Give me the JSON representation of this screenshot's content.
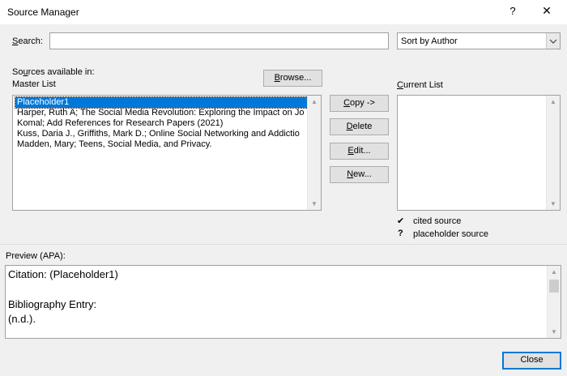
{
  "window": {
    "title": "Source Manager",
    "help_glyph": "?",
    "close_glyph": "✕"
  },
  "search": {
    "label_prefix": "",
    "label_accel": "S",
    "label_rest": "earch:",
    "value": "",
    "placeholder": ""
  },
  "sort": {
    "selected": "Sort by Author",
    "arrow": "⌵"
  },
  "sources": {
    "label_pre": "So",
    "label_accel": "u",
    "label_post": "rces available in:",
    "list_name": "Master List",
    "browse_pre": "",
    "browse_accel": "B",
    "browse_post": "rowse...",
    "items": [
      "Placeholder1",
      "Harper, Ruth A; The Social Media Revolution: Exploring the Impact on Jo",
      "Komal; Add References for Research Papers (2021)",
      "Kuss, Daria J., Griffiths, Mark D.; Online Social Networking and Addictio",
      "Madden, Mary; Teens, Social Media, and Privacy."
    ],
    "selected_index": 0
  },
  "actions": {
    "copy_accel": "C",
    "copy_rest": "opy ->",
    "delete_accel": "D",
    "delete_rest": "elete",
    "edit_accel": "E",
    "edit_rest": "dit...",
    "new_accel": "N",
    "new_rest": "ew..."
  },
  "current": {
    "label_accel": "C",
    "label_rest": "urrent List",
    "items": []
  },
  "legend": {
    "cited_symbol": "✔",
    "cited_label": "cited source",
    "placeholder_symbol": "?",
    "placeholder_label": "placeholder source"
  },
  "preview": {
    "label": "Preview (APA):",
    "citation": "Citation:  (Placeholder1)",
    "bibliography_heading": "Bibliography Entry:",
    "bibliography_value": "(n.d.)."
  },
  "footer": {
    "close_label": "Close"
  }
}
